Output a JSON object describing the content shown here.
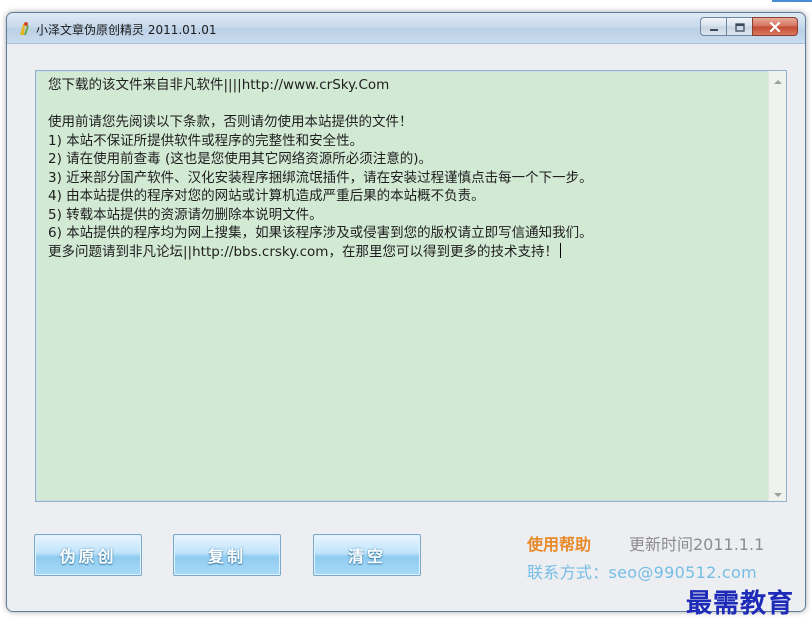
{
  "window": {
    "title": "小泽文章伪原创精灵 2011.01.01"
  },
  "editor": {
    "text": "您下载的该文件来自非凡软件||||http://www.crSky.Com\n\n使用前请您先阅读以下条款，否则请勿使用本站提供的文件！\n1) 本站不保证所提供软件或程序的完整性和安全性。\n2) 请在使用前查毒 (这也是您使用其它网络资源所必须注意的)。\n3) 近来部分国产软件、汉化安装程序捆绑流氓插件，请在安装过程谨慎点击每一个下一步。\n4) 由本站提供的程序对您的网站或计算机造成严重后果的本站概不负责。\n5) 转载本站提供的资源请勿删除本说明文件。\n6) 本站提供的程序均为网上搜集，如果该程序涉及或侵害到您的版权请立即写信通知我们。\n更多问题请到非凡论坛||http://bbs.crsky.com，在那里您可以得到更多的技术支持！"
  },
  "buttons": {
    "pseudo_original": "伪原创",
    "copy": "复制",
    "clear": "清空"
  },
  "footer": {
    "help": "使用帮助",
    "update": "更新时间2011.1.1",
    "contact": "联系方式：seo@990512.com"
  },
  "watermark": "最需教育",
  "colors": {
    "editor_bg": "#d2e9d4",
    "help": "#e88a2a",
    "contact": "#76bde6",
    "button_top": "#bfe3fa",
    "button_bottom": "#8fccf0",
    "watermark": "#1e2bb8"
  },
  "icons": {
    "app": "app-logo-icon",
    "minimize": "minimize-icon",
    "maximize": "maximize-icon",
    "close": "close-icon",
    "scroll_up": "chevron-up-icon",
    "scroll_down": "chevron-down-icon"
  }
}
